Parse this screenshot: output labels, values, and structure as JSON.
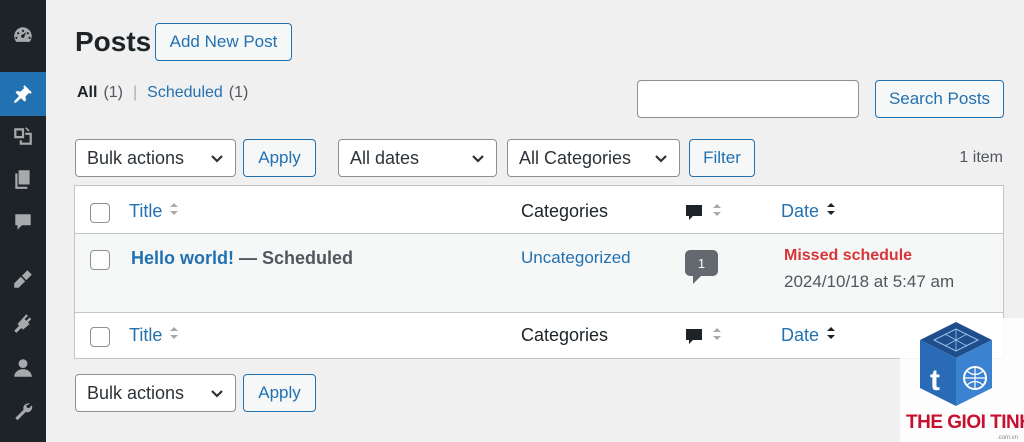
{
  "header": {
    "title": "Posts",
    "add_new_label": "Add New Post"
  },
  "views": {
    "all_label": "All",
    "all_count": "(1)",
    "separator": "|",
    "scheduled_label": "Scheduled",
    "scheduled_count": "(1)"
  },
  "search": {
    "button_label": "Search Posts",
    "value": ""
  },
  "filters": {
    "bulk_actions": "Bulk actions",
    "apply_label": "Apply",
    "dates": "All dates",
    "categories": "All Categories",
    "filter_label": "Filter"
  },
  "items_count": "1 item",
  "table": {
    "columns": {
      "title": "Title",
      "categories": "Categories",
      "date": "Date"
    },
    "rows": [
      {
        "title": "Hello world!",
        "state": " — Scheduled",
        "category": "Uncategorized",
        "comments": "1",
        "date_status": "Missed schedule",
        "date": "2024/10/18 at 5:47 am"
      }
    ]
  },
  "bottom": {
    "bulk_actions": "Bulk actions",
    "apply_label": "Apply"
  },
  "watermark": {
    "brand": "THE GIOI TINHOC",
    "domain": ".com.vn"
  },
  "sidebar": {
    "icons": [
      "dashboard-icon",
      "pin-icon",
      "media-icon",
      "pages-icon",
      "comments-icon",
      "appearance-icon",
      "plugins-icon",
      "users-icon",
      "tools-icon"
    ]
  },
  "colors": {
    "accent": "#2271b1",
    "sidebar": "#1d2327",
    "error": "#d63638"
  }
}
